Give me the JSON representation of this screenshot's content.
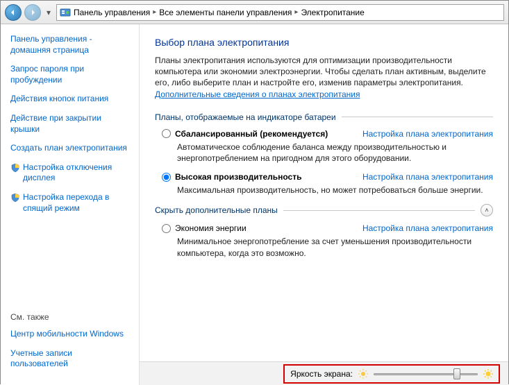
{
  "breadcrumb": {
    "level1": "Панель управления",
    "level2": "Все элементы панели управления",
    "level3": "Электропитание"
  },
  "sidebar": {
    "home": "Панель управления - домашняя страница",
    "links": [
      "Запрос пароля при пробуждении",
      "Действия кнопок питания",
      "Действие при закрытии крышки",
      "Создать план электропитания",
      "Настройка отключения дисплея",
      "Настройка перехода в спящий режим"
    ],
    "see_also_hdr": "См. также",
    "see_also": [
      "Центр мобильности Windows",
      "Учетные записи пользователей"
    ]
  },
  "heading": "Выбор плана электропитания",
  "intro_text": "Планы электропитания используются для оптимизации производительности компьютера или экономии электроэнергии. Чтобы сделать план активным, выделите его, либо выберите план и настройте его, изменив параметры электропитания. ",
  "intro_link": "Дополнительные сведения о планах электропитания",
  "group1_title": "Планы, отображаемые на индикаторе батареи",
  "group2_title": "Скрыть дополнительные планы",
  "plans": [
    {
      "name": "Сбалансированный (рекомендуется)",
      "desc": "Автоматическое соблюдение баланса между производительностью и энергопотреблением на пригодном для этого оборудовании.",
      "config": "Настройка плана электропитания"
    },
    {
      "name": "Высокая производительность",
      "desc": "Максимальная производительность, но может потребоваться больше энергии.",
      "config": "Настройка плана электропитания"
    },
    {
      "name": "Экономия энергии",
      "desc": "Минимальное энергопотребление за счет уменьшения производительности компьютера, когда это возможно.",
      "config": "Настройка плана электропитания"
    }
  ],
  "brightness_label": "Яркость экрана:",
  "brightness_percent": 82
}
